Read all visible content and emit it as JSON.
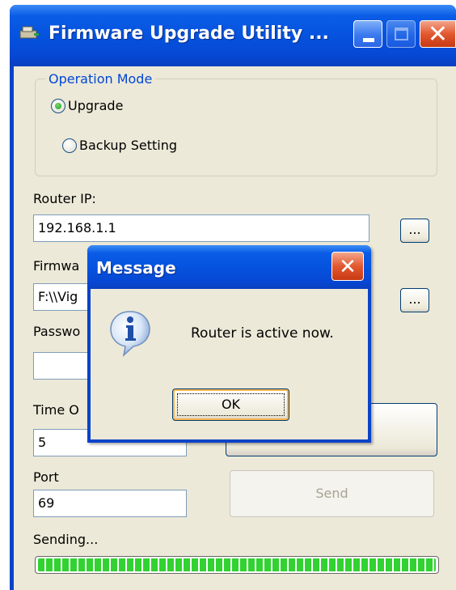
{
  "window": {
    "title": "Firmware Upgrade Utility ...",
    "accent": "#0553de"
  },
  "operation_mode": {
    "legend": "Operation Mode",
    "options": [
      {
        "label": "Upgrade",
        "selected": true
      },
      {
        "label": "Backup Setting",
        "selected": false
      }
    ]
  },
  "router_ip": {
    "label": "Router IP:",
    "value": "192.168.1.1",
    "browse_label": "..."
  },
  "firmware": {
    "label_visible": "Firmwa",
    "value_visible": "F:\\\\Vig",
    "browse_label": "..."
  },
  "password": {
    "label_visible": "Passwo",
    "value": ""
  },
  "timeout": {
    "label_visible": "Time O",
    "value": "5"
  },
  "port": {
    "label": "Port",
    "value": "69"
  },
  "send_button": {
    "label": "Send",
    "enabled": false
  },
  "status": {
    "text": "Sending...",
    "progress": 1.0,
    "progress_color": "#31d231"
  },
  "dialog": {
    "title": "Message",
    "icon": "info-icon",
    "message": "Router is active now.",
    "ok_label": "OK"
  }
}
